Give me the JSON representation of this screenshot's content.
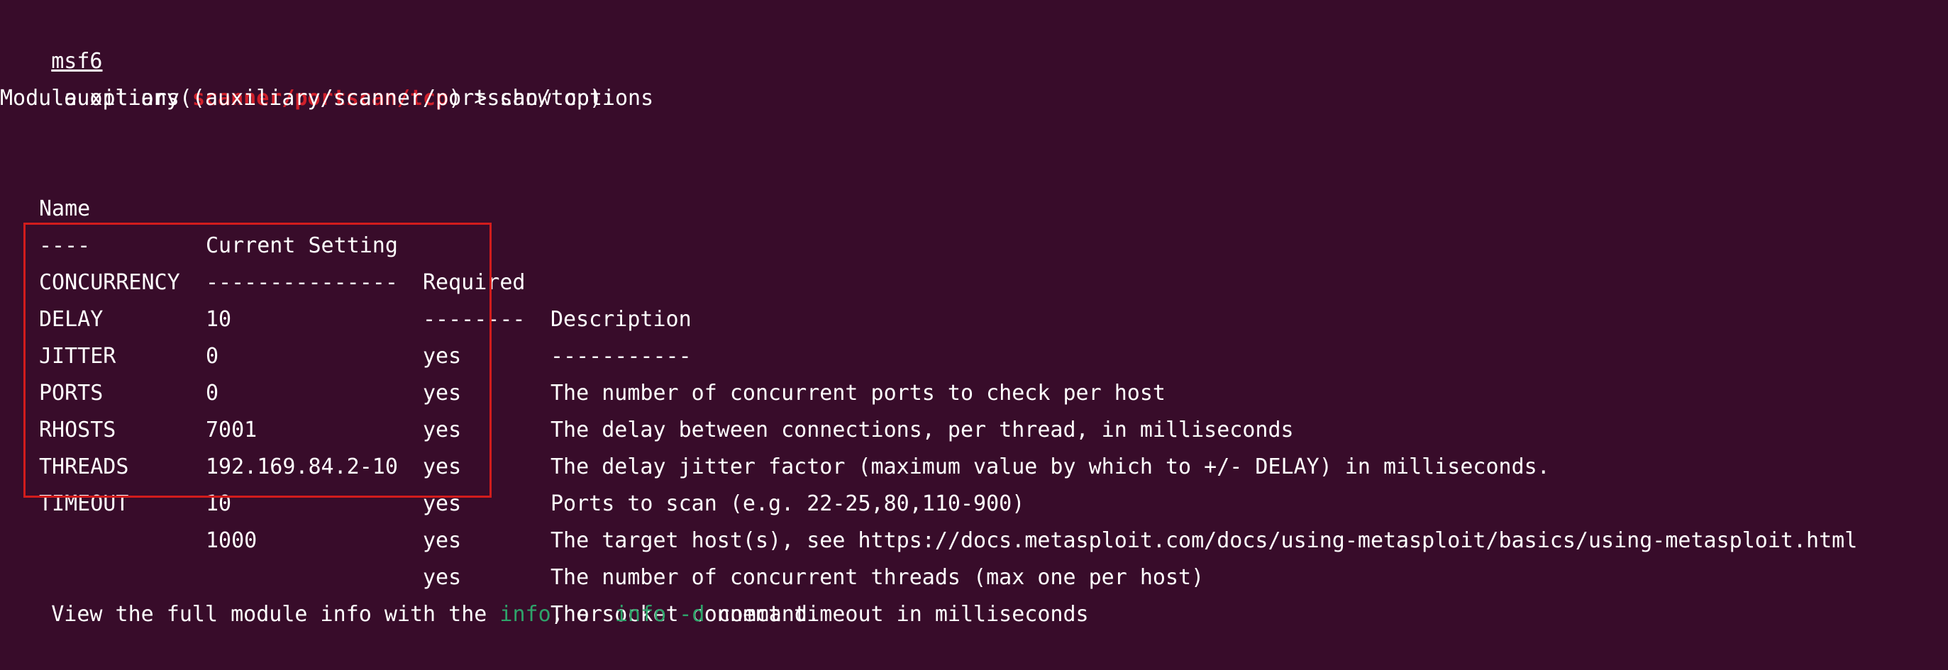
{
  "prompt": {
    "console": "msf6",
    "type": "auxiliary",
    "open_paren": "(",
    "module": "scanner/portscan/tcp",
    "close": ")",
    "arrow": " > ",
    "command": "show options"
  },
  "module_options_title": "Module options (auxiliary/scanner/portscan/tcp):",
  "table": {
    "headers": {
      "name": "Name",
      "setting": "Current Setting",
      "required": "Required",
      "description": "Description"
    },
    "separators": {
      "name": "----",
      "setting": "---------------",
      "required": "--------",
      "description": "-----------"
    },
    "rows": [
      {
        "name": "CONCURRENCY",
        "setting": "10",
        "required": "yes",
        "description": "The number of concurrent ports to check per host"
      },
      {
        "name": "DELAY",
        "setting": "0",
        "required": "yes",
        "description": "The delay between connections, per thread, in milliseconds"
      },
      {
        "name": "JITTER",
        "setting": "0",
        "required": "yes",
        "description": "The delay jitter factor (maximum value by which to +/- DELAY) in milliseconds."
      },
      {
        "name": "PORTS",
        "setting": "7001",
        "required": "yes",
        "description": "Ports to scan (e.g. 22-25,80,110-900)"
      },
      {
        "name": "RHOSTS",
        "setting": "192.169.84.2-10",
        "required": "yes",
        "description": "The target host(s), see https://docs.metasploit.com/docs/using-metasploit/basics/using-metasploit.html"
      },
      {
        "name": "THREADS",
        "setting": "10",
        "required": "yes",
        "description": "The number of concurrent threads (max one per host)"
      },
      {
        "name": "TIMEOUT",
        "setting": "1000",
        "required": "yes",
        "description": "The socket connect timeout in milliseconds"
      }
    ]
  },
  "footer": {
    "prefix": "View the full module info with the ",
    "info_cmd": "info",
    "middle": ", or ",
    "info_d_cmd": "info -d",
    "suffix": " command."
  },
  "colors": {
    "background": "#380c2a",
    "text": "#ffffff",
    "module_red": "#d0202b",
    "command_green": "#2ea36a",
    "highlight_box": "#d21c1c"
  }
}
